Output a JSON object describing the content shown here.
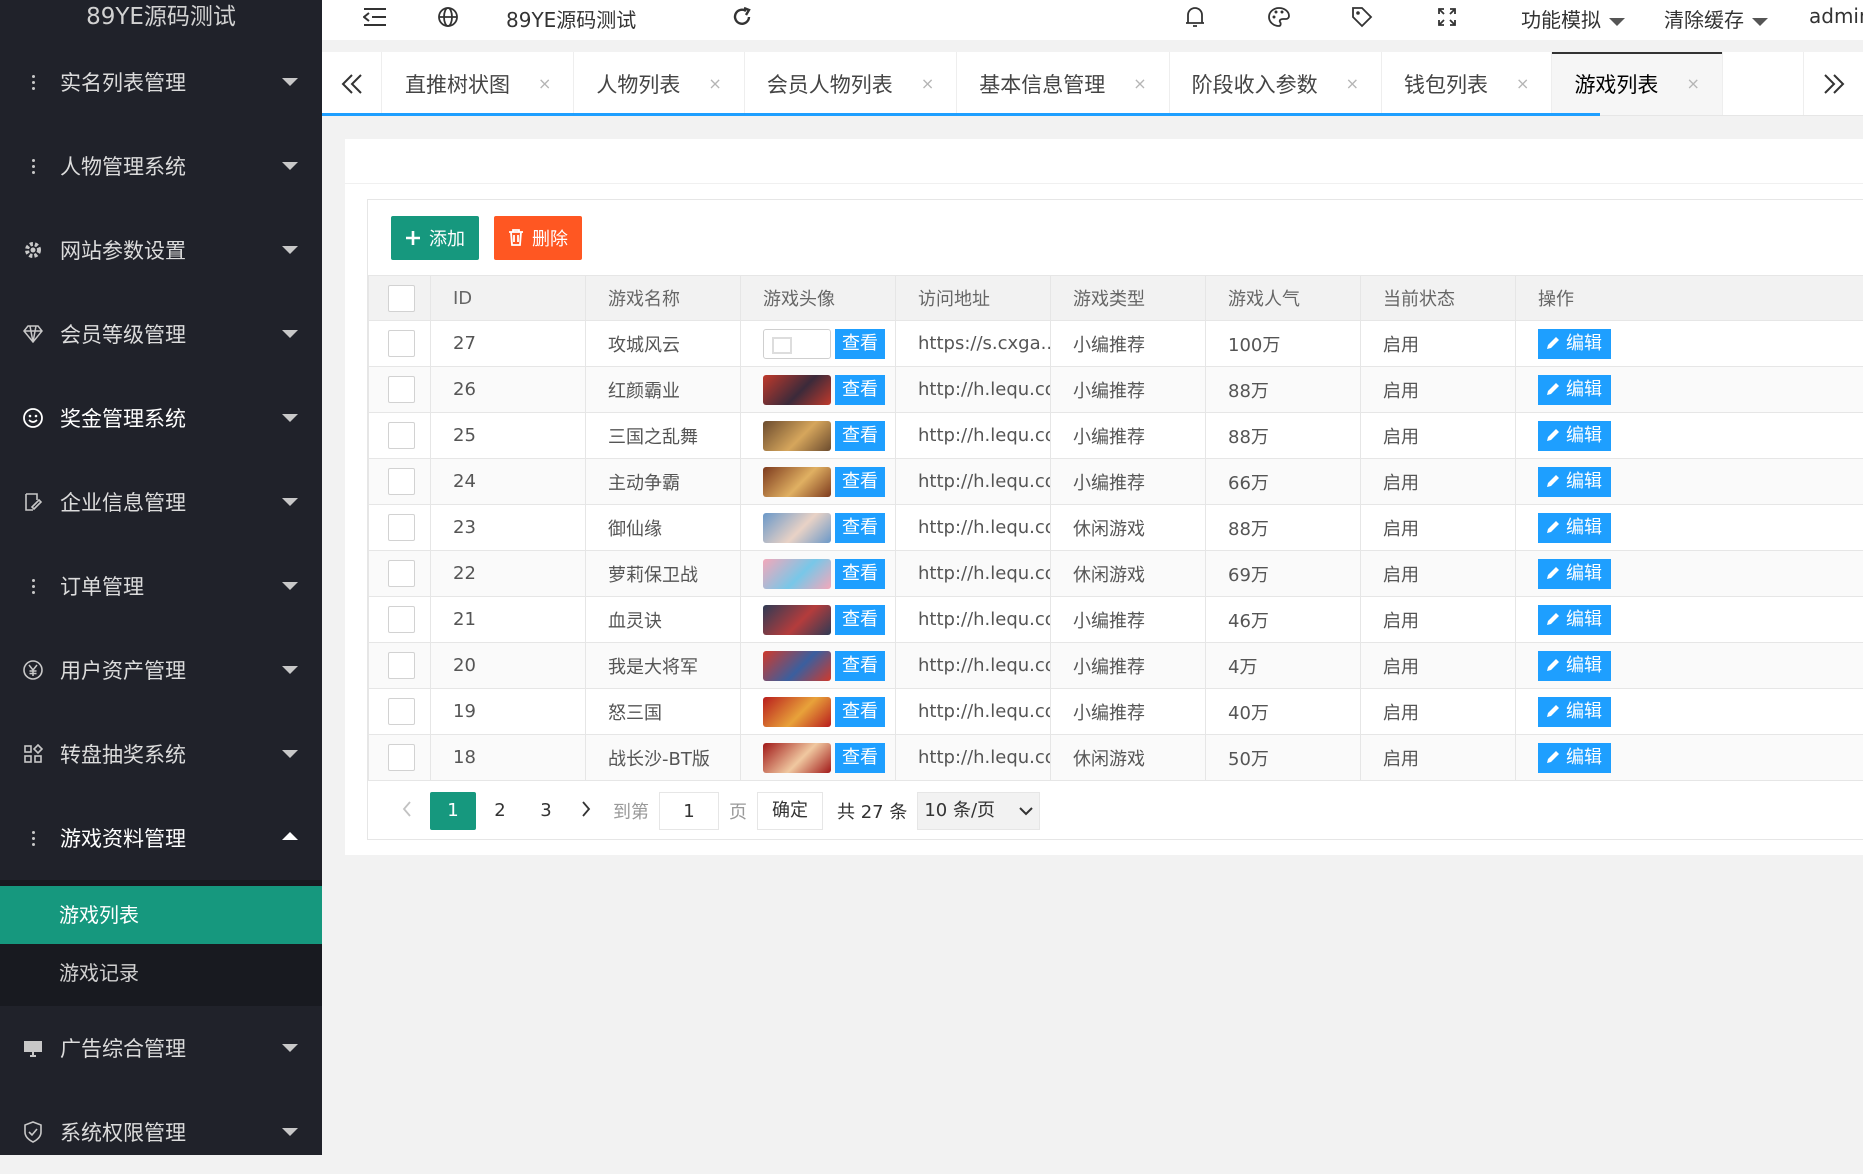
{
  "app": {
    "title": "89YE源码测试"
  },
  "sidebar": {
    "items": [
      {
        "label": "实名列表管理",
        "icon": "dots-icon"
      },
      {
        "label": "人物管理系统",
        "icon": "dots-icon"
      },
      {
        "label": "网站参数设置",
        "icon": "gear-icon"
      },
      {
        "label": "会员等级管理",
        "icon": "diamond-icon"
      },
      {
        "label": "奖金管理系统",
        "icon": "smile-icon"
      },
      {
        "label": "企业信息管理",
        "icon": "edit-icon"
      },
      {
        "label": "订单管理",
        "icon": "dots-icon"
      },
      {
        "label": "用户资产管理",
        "icon": "yen-icon"
      },
      {
        "label": "转盘抽奖系统",
        "icon": "apps-icon"
      },
      {
        "label": "游戏资料管理",
        "icon": "dots-icon"
      },
      {
        "label": "广告综合管理",
        "icon": "monitor-icon"
      },
      {
        "label": "系统权限管理",
        "icon": "shield-icon"
      }
    ],
    "submenu": [
      {
        "label": "游戏列表"
      },
      {
        "label": "游戏记录"
      }
    ]
  },
  "header": {
    "site_name": "89YE源码测试",
    "func_sim": "功能模拟",
    "clear_cache": "清除缓存",
    "user": "admin"
  },
  "tabs": [
    {
      "label": "直推树状图",
      "close": "×"
    },
    {
      "label": "人物列表",
      "close": "×"
    },
    {
      "label": "会员人物列表",
      "close": "×"
    },
    {
      "label": "基本信息管理",
      "close": "×"
    },
    {
      "label": "阶段收入参数",
      "close": "×"
    },
    {
      "label": "钱包列表",
      "close": "×"
    },
    {
      "label": "游戏列表",
      "close": "×"
    }
  ],
  "toolbar": {
    "add": "添加",
    "delete": "删除"
  },
  "table": {
    "columns": [
      "ID",
      "游戏名称",
      "游戏头像",
      "访问地址",
      "游戏类型",
      "游戏人气",
      "当前状态",
      "操作"
    ],
    "view_label": "查看",
    "edit_label": "编辑",
    "rows": [
      {
        "id": "27",
        "name": "攻城风云",
        "url": "https://s.cxga...",
        "type": "小编推荐",
        "pop": "100万",
        "status": "启用"
      },
      {
        "id": "26",
        "name": "红颜霸业",
        "url": "http://h.lequ.co...",
        "type": "小编推荐",
        "pop": "88万",
        "status": "启用"
      },
      {
        "id": "25",
        "name": "三国之乱舞",
        "url": "http://h.lequ.co...",
        "type": "小编推荐",
        "pop": "88万",
        "status": "启用"
      },
      {
        "id": "24",
        "name": "主动争霸",
        "url": "http://h.lequ.co...",
        "type": "小编推荐",
        "pop": "66万",
        "status": "启用"
      },
      {
        "id": "23",
        "name": "御仙缘",
        "url": "http://h.lequ.co...",
        "type": "休闲游戏",
        "pop": "88万",
        "status": "启用"
      },
      {
        "id": "22",
        "name": "萝莉保卫战",
        "url": "http://h.lequ.co...",
        "type": "休闲游戏",
        "pop": "69万",
        "status": "启用"
      },
      {
        "id": "21",
        "name": "血灵诀",
        "url": "http://h.lequ.co...",
        "type": "小编推荐",
        "pop": "46万",
        "status": "启用"
      },
      {
        "id": "20",
        "name": "我是大将军",
        "url": "http://h.lequ.co...",
        "type": "小编推荐",
        "pop": "4万",
        "status": "启用"
      },
      {
        "id": "19",
        "name": "怒三国",
        "url": "http://h.lequ.co...",
        "type": "小编推荐",
        "pop": "40万",
        "status": "启用"
      },
      {
        "id": "18",
        "name": "战长沙-BT版",
        "url": "http://h.lequ.co...",
        "type": "休闲游戏",
        "pop": "50万",
        "status": "启用"
      }
    ]
  },
  "pager": {
    "pages": [
      "1",
      "2",
      "3"
    ],
    "goto_label": "到第",
    "page_value": "1",
    "page_unit": "页",
    "confirm": "确定",
    "total": "共 27 条",
    "per_page": "10 条/页"
  },
  "colors": {
    "sidebar": "#20222a",
    "accent": "#16987e",
    "danger": "#ff5722",
    "primary": "#1e9fff"
  }
}
